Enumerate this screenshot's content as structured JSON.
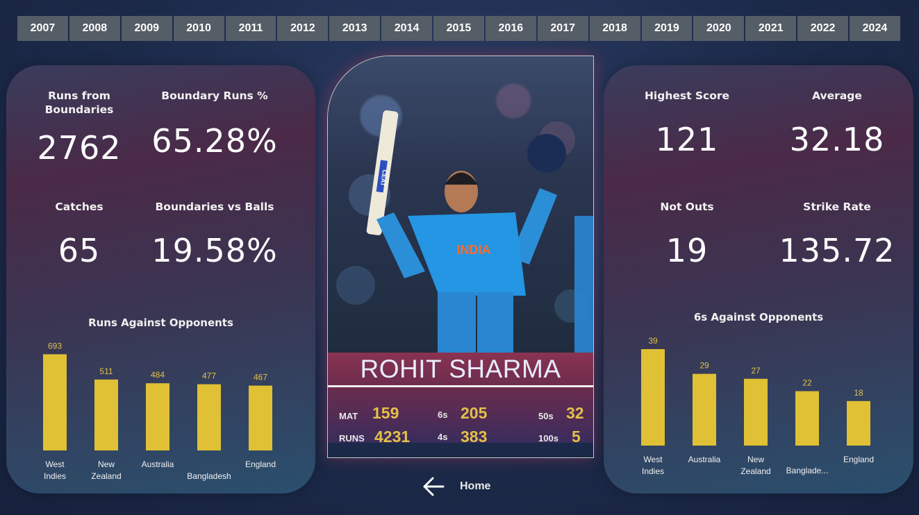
{
  "years": [
    "2007",
    "2008",
    "2009",
    "2010",
    "2011",
    "2012",
    "2013",
    "2014",
    "2015",
    "2016",
    "2017",
    "2018",
    "2019",
    "2020",
    "2021",
    "2022",
    "2024"
  ],
  "left_kpis": {
    "runs_boundaries": {
      "label": "Runs from Boundaries",
      "value": "2762"
    },
    "boundary_pct": {
      "label": "Boundary Runs %",
      "value": "65.28%"
    },
    "catches": {
      "label": "Catches",
      "value": "65"
    },
    "boundaries_balls": {
      "label": "Boundaries vs Balls",
      "value": "19.58%"
    }
  },
  "right_kpis": {
    "highest": {
      "label": "Highest Score",
      "value": "121"
    },
    "average": {
      "label": "Average",
      "value": "32.18"
    },
    "not_outs": {
      "label": "Not Outs",
      "value": "19"
    },
    "strike_rate": {
      "label": "Strike Rate",
      "value": "135.72"
    }
  },
  "player": {
    "name": "ROHIT SHARMA",
    "jersey_text": "INDIA",
    "bat_text": "CEAT",
    "stats": {
      "mat_label": "MAT",
      "mat": "159",
      "runs_label": "RUNS",
      "runs": "4231",
      "sixes_label": "6s",
      "sixes": "205",
      "fours_label": "4s",
      "fours": "383",
      "fifties_label": "50s",
      "fifties": "32",
      "hundreds_label": "100s",
      "hundreds": "5"
    }
  },
  "home": {
    "label": "Home",
    "icon": "arrow-left-icon"
  },
  "colors": {
    "bar": "#e0c034",
    "value_label": "#e3c04a",
    "year_button": "#555d66"
  },
  "chart_data": [
    {
      "type": "bar",
      "title": "Runs Against Opponents",
      "categories": [
        "West Indies",
        "New Zealand",
        "Australia",
        "Bangladesh",
        "England"
      ],
      "values": [
        693,
        511,
        484,
        477,
        467
      ],
      "ylim": [
        0,
        700
      ],
      "grid": false
    },
    {
      "type": "bar",
      "title": "6s Against Opponents",
      "categories": [
        "West Indies",
        "Australia",
        "New Zealand",
        "Banglade...",
        "England"
      ],
      "values": [
        39,
        29,
        27,
        22,
        18
      ],
      "ylim": [
        0,
        39
      ],
      "grid": false
    }
  ]
}
